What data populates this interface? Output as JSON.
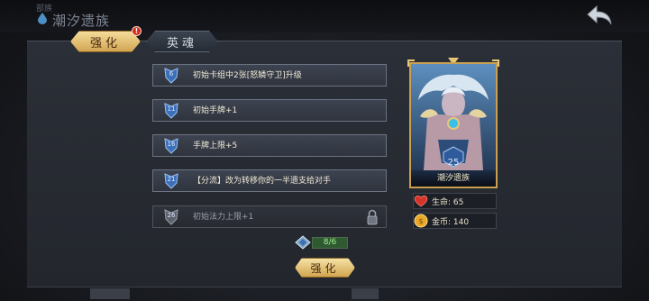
{
  "header": {
    "faction_tag": "部族",
    "title": "潮汐遗族"
  },
  "tabs": [
    {
      "label": "强化",
      "active": true,
      "badge": "!"
    },
    {
      "label": "英魂",
      "active": false
    }
  ],
  "upgrades": [
    {
      "level": "6",
      "text": "初始卡组中2张[怒鳞守卫]升级",
      "locked": false
    },
    {
      "level": "11",
      "text": "初始手牌+1",
      "locked": false
    },
    {
      "level": "16",
      "text": "手牌上限+5",
      "locked": false
    },
    {
      "level": "21",
      "text": "【分流】改为转移你的一半遗支给对手",
      "locked": false
    },
    {
      "level": "26",
      "text": "初始法力上限+1",
      "locked": true
    }
  ],
  "progress": {
    "text": "8/6",
    "fraction": 1.0
  },
  "upgrade_button": "强化",
  "hero": {
    "name": "潮汐遗族",
    "level": "25"
  },
  "stats": {
    "hp_label": "生命: 65",
    "gold_label": "金币: 140"
  },
  "colors": {
    "gold_accent": "#d2a652",
    "panel": "#2b2f37",
    "progress_text": "#9ff08e",
    "hp_red": "#d8332a",
    "gold_coin": "#e8a92a"
  }
}
